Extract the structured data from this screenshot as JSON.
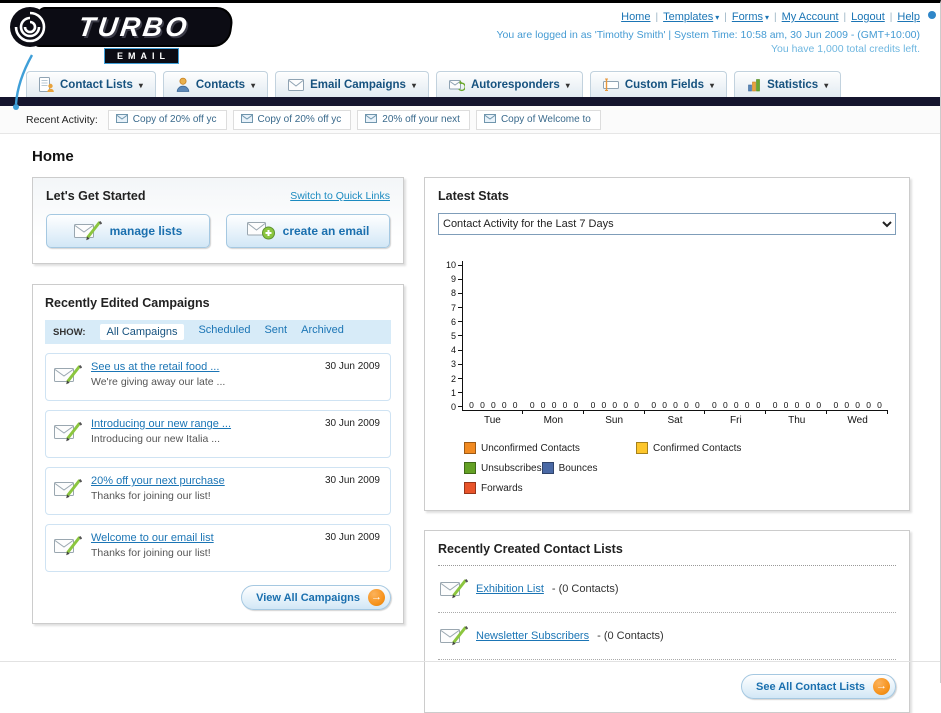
{
  "header": {
    "logo_title": "TURBO",
    "logo_subtitle": "EMAIL",
    "nav_links": [
      {
        "label": "Home",
        "dropdown": false
      },
      {
        "label": "Templates",
        "dropdown": true
      },
      {
        "label": "Forms",
        "dropdown": true
      },
      {
        "label": "My Account",
        "dropdown": false
      },
      {
        "label": "Logout",
        "dropdown": false
      },
      {
        "label": "Help",
        "dropdown": false
      }
    ],
    "login_info": "You are logged in as 'Timothy Smith' | System Time: 10:58 am, 30 Jun 2009 - (GMT+10:00)",
    "credits": "You have 1,000 total credits left."
  },
  "main_nav": [
    {
      "label": "Contact Lists",
      "icon": "contact-lists-icon"
    },
    {
      "label": "Contacts",
      "icon": "contacts-icon"
    },
    {
      "label": "Email Campaigns",
      "icon": "email-campaigns-icon"
    },
    {
      "label": "Autoresponders",
      "icon": "autoresponders-icon"
    },
    {
      "label": "Custom Fields",
      "icon": "custom-fields-icon"
    },
    {
      "label": "Statistics",
      "icon": "statistics-icon"
    }
  ],
  "recent_activity": {
    "label": "Recent Activity:",
    "items": [
      {
        "label": "Copy of 20% off yc",
        "icon": "envelope-icon"
      },
      {
        "label": "Copy of 20% off yc",
        "icon": "envelope-icon"
      },
      {
        "label": "20% off your next",
        "icon": "envelope-icon"
      },
      {
        "label": "Copy of Welcome to",
        "icon": "envelope-icon"
      }
    ]
  },
  "page_title": "Home",
  "get_started": {
    "title": "Let's Get Started",
    "switch_link": "Switch to Quick Links",
    "buttons": [
      {
        "label": "manage lists",
        "icon": "pencil-envelope-icon"
      },
      {
        "label": "create an email",
        "icon": "create-email-icon"
      }
    ]
  },
  "campaigns": {
    "title": "Recently Edited Campaigns",
    "show_label": "SHOW:",
    "filter_tabs": [
      {
        "label": "All Campaigns",
        "active": true
      },
      {
        "label": "Scheduled",
        "active": false
      },
      {
        "label": "Sent",
        "active": false
      },
      {
        "label": "Archived",
        "active": false
      }
    ],
    "items": [
      {
        "title": "See us at the retail food ...",
        "subtitle": "We're giving away our late ...",
        "date": "30 Jun 2009",
        "icon": "pencil-envelope-icon"
      },
      {
        "title": "Introducing our new range ...",
        "subtitle": "Introducing our new Italia ...",
        "date": "30 Jun 2009",
        "icon": "pencil-envelope-icon"
      },
      {
        "title": "20% off your next purchase",
        "subtitle": "Thanks for joining our list!",
        "date": "30 Jun 2009",
        "icon": "pencil-envelope-icon"
      },
      {
        "title": "Welcome to our email list",
        "subtitle": "Thanks for joining our list!",
        "date": "30 Jun 2009",
        "icon": "pencil-envelope-icon"
      }
    ],
    "view_all_label": "View All Campaigns"
  },
  "stats": {
    "title": "Latest Stats",
    "selected_option": "Contact Activity for the Last 7 Days",
    "chart_data": {
      "type": "bar",
      "title": "Contact Activity for the Last 7 Days",
      "categories": [
        "Tue",
        "Mon",
        "Sun",
        "Sat",
        "Fri",
        "Thu",
        "Wed"
      ],
      "series": [
        {
          "name": "Unconfirmed Contacts",
          "color": "#f18a21",
          "values": [
            0,
            0,
            0,
            0,
            0,
            0,
            0
          ]
        },
        {
          "name": "Confirmed Contacts",
          "color": "#fdc62b",
          "values": [
            0,
            0,
            0,
            0,
            0,
            0,
            0
          ]
        },
        {
          "name": "Unsubscribes",
          "color": "#64a125",
          "values": [
            0,
            0,
            0,
            0,
            0,
            0,
            0
          ]
        },
        {
          "name": "Bounces",
          "color": "#4a69a5",
          "values": [
            0,
            0,
            0,
            0,
            0,
            0,
            0
          ]
        },
        {
          "name": "Forwards",
          "color": "#e8542a",
          "values": [
            0,
            0,
            0,
            0,
            0,
            0,
            0
          ]
        }
      ],
      "ylim": [
        0,
        10
      ],
      "yticks": [
        0,
        1,
        2,
        3,
        4,
        5,
        6,
        7,
        8,
        9,
        10
      ],
      "value_labels_shown": true,
      "legend_position": "bottom",
      "grid": false
    }
  },
  "contact_lists": {
    "title": "Recently Created Contact Lists",
    "items": [
      {
        "name": "Exhibition List",
        "count": "- (0 Contacts)",
        "icon": "pencil-envelope-icon"
      },
      {
        "name": "Newsletter Subscribers",
        "count": "- (0 Contacts)",
        "icon": "pencil-envelope-icon"
      }
    ],
    "see_all_label": "See All Contact Lists"
  },
  "colors": {
    "link_blue": "#1b75b5",
    "accent_orange": "#f7941e",
    "dark_bar": "#15152e"
  }
}
